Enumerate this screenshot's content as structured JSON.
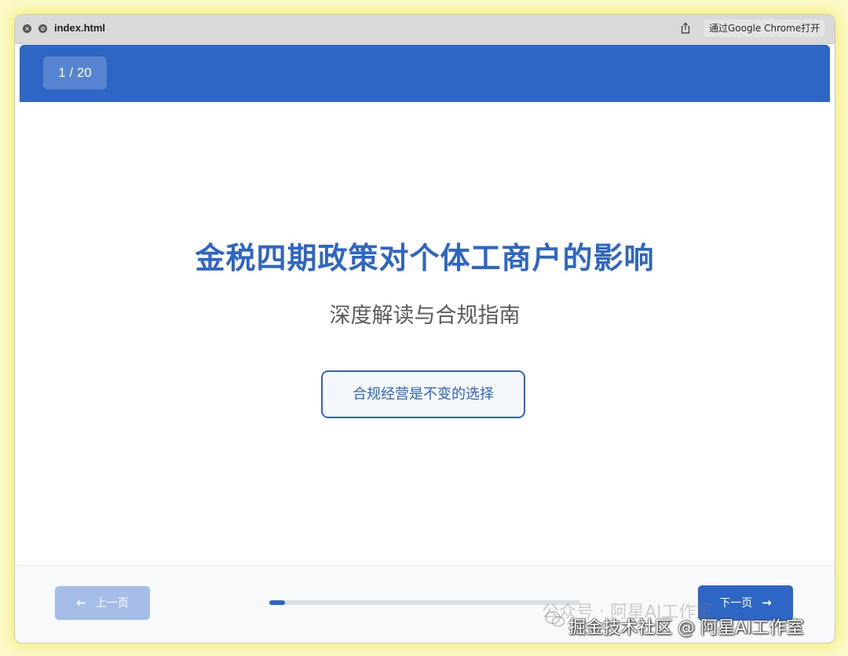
{
  "window": {
    "title": "index.html",
    "open_in_chrome_label": "通过Google Chrome打开"
  },
  "topbar": {
    "page_counter": "1 / 20",
    "accent_color": "#2e66c6"
  },
  "slide": {
    "title": "金税四期政策对个体工商户的影响",
    "subtitle": "深度解读与合规指南",
    "tag": "合规经营是不变的选择"
  },
  "footer": {
    "prev_label": "上一页",
    "next_label": "下一页",
    "progress_fraction": 0.05
  },
  "watermark": {
    "faint_text": "公众号 · 阿星AI工作室",
    "main_text": "掘金技术社区 @ 阿星AI工作室"
  },
  "icons": {
    "close": "close-icon",
    "stop": "stop-icon",
    "share": "share-icon",
    "prev_arrow": "arrow-left-icon",
    "next_arrow": "arrow-right-icon",
    "wechat": "wechat-icon"
  }
}
